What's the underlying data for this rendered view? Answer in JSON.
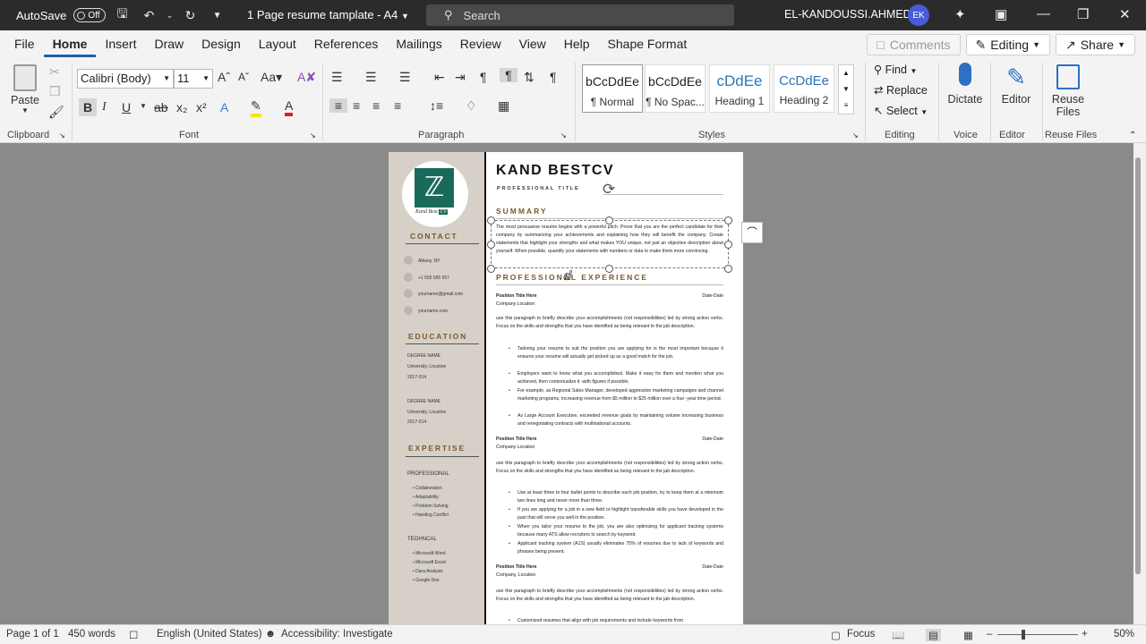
{
  "titlebar": {
    "autosave_label": "AutoSave",
    "autosave_state": "Off",
    "doc_title": "1 Page resume tamplate - A4",
    "search_placeholder": "Search",
    "user_name": "EL-KANDOUSSI.AHMED",
    "user_initials": "EK"
  },
  "menu": {
    "items": [
      "File",
      "Home",
      "Insert",
      "Draw",
      "Design",
      "Layout",
      "References",
      "Mailings",
      "Review",
      "View",
      "Help",
      "Shape Format"
    ],
    "active": "Home",
    "comments_label": "Comments",
    "editing_label": "Editing",
    "share_label": "Share"
  },
  "ribbon": {
    "clipboard": {
      "paste_label": "Paste",
      "group_label": "Clipboard"
    },
    "font": {
      "font_name": "Calibri (Body)",
      "font_size": "11",
      "group_label": "Font"
    },
    "paragraph": {
      "group_label": "Paragraph"
    },
    "styles": {
      "group_label": "Styles",
      "items": [
        {
          "preview": "bCcDdEe",
          "name": "¶ Normal"
        },
        {
          "preview": "bCcDdEe",
          "name": "¶ No Spac..."
        },
        {
          "preview": "cDdEe",
          "name": "Heading 1"
        },
        {
          "preview": "CcDdEe",
          "name": "Heading 2"
        }
      ]
    },
    "editing": {
      "find_label": "Find",
      "replace_label": "Replace",
      "select_label": "Select",
      "group_label": "Editing"
    },
    "voice": {
      "dictate_label": "Dictate",
      "group_label": "Voice"
    },
    "editor": {
      "editor_label": "Editor",
      "group_label": "Editor"
    },
    "reuse": {
      "label_line1": "Reuse",
      "label_line2": "Files",
      "group_label": "Reuse Files"
    }
  },
  "resume": {
    "logo_text": "Kand Best",
    "logo_cv": "CV",
    "name": "KAND BESTCV",
    "title": "PROFESSIONAL TITLE",
    "contact_heading": "CONTACT",
    "contact": [
      "Albany, NY",
      "+1 555 555 557",
      "yourname@gmail.com",
      "yourname.com"
    ],
    "education_heading": "EDUCATION",
    "education": [
      {
        "degree": "DEGREE NAME",
        "school": "University, Location",
        "years": "2017-014"
      },
      {
        "degree": "DEGREE NAME",
        "school": "University, Location",
        "years": "2017-014"
      }
    ],
    "expertise_heading": "EXPERTISE",
    "professional_label": "PROFESSIONAL",
    "professional_skills": [
      "Collaboration",
      "Adaptability",
      "Problem Solving",
      "Handing Conflict"
    ],
    "technical_label": "TEOHNCAL",
    "technical_skills": [
      "Microsoft Word",
      "Microsoft Excel",
      "Dara Analysis",
      "Google Dos"
    ],
    "summary_heading": "SUMMARY",
    "summary_text": "The most persuasive resume begins with a powerful pitch. Prove that you are the perfect candidate for their company by summarizing your achievements and explaining how they will benefit the company. Create statements that highlight your strengths and what makes YOU unique, not just an objective description about yourself. When possible, quantify your statements with numbers or data to make them more convincing.",
    "experience_heading": "PROFESSIONAL EXPERIENCE",
    "jobs": [
      {
        "title": "Position Title Here",
        "date": "Date-Date",
        "company": "Company Location",
        "description": "use this paragraph to briefly describe your accomplishments (not responsibilities) led by strong action verbs. Focus on the skills and strengths that you have identified as being relevant to the jab description.",
        "bullets": [
          "Tailoring your resume to suit the position you are applying for is the most important because it ensures your resume will actually get picked up as a good match for the job.",
          "Employers want to know what you accomplished. Make it easy for them and mention what you achieved, then contextualize it -with figures if possible.",
          "For example, as Regional Sales Manager, developed aggressive marketing campaigns and channel marketing programs, increasing revenue from $5 million to $25 million over a four -year time period.",
          "As Large Account Executive, exceeded revenue goals by maintaining volume increasing business and renegotiating contracts with multinational accounts."
        ]
      },
      {
        "title": "Position Title Here",
        "date": "Date-Date",
        "company": "Company Location",
        "description": "use this paragraph to briefly describe your accomplishments (not responsibilities) led by strong action verbs. Focus on the skills and strengths that you have identified as being relevant to the jab description.",
        "bullets": [
          "Use at least three to four bullet points to describe each job position, try to keep them at a minimum two lines long and never more than three.",
          "If you are applying for a job in a new field or highlight transferable skills you have developed in the past that will serve you well in the position.",
          "When you tailor your resume to the job, you are also optimizing for applicant tracking systems because many ATS allow recruiters to search by keyword.",
          "Applicant tracking system (A1S) usually eliminates 75% of resumes due to lack of keywords and phrases being present."
        ]
      },
      {
        "title": "Position Title Here",
        "date": "Date-Date",
        "company": "Company, Location",
        "description": "use this paragraph to briefly describe your accomplishments (not responsibilities) led by strong action verbs. Focus on the skills and strengths that you have identified as being relevant to the jab description.",
        "bullets": [
          "Customized resumes that align with job requirements and include keywords from"
        ]
      }
    ]
  },
  "status": {
    "page": "Page 1 of 1",
    "words": "450 words",
    "language": "English (United States)",
    "accessibility": "Accessibility: Investigate",
    "focus": "Focus",
    "zoom": "50%"
  },
  "colors": {
    "accent": "#1f5fad",
    "heading_brown": "#7a5a2e",
    "sidebar": "#d6d0c8"
  }
}
